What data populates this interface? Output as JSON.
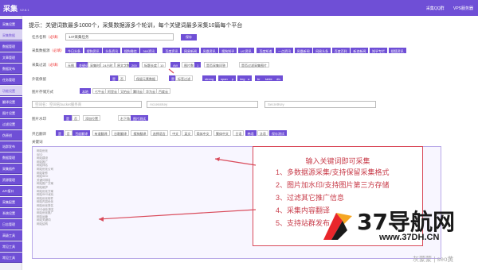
{
  "app": {
    "title": "采集",
    "version": "V2.8.1"
  },
  "topbar": {
    "links": [
      "采集QQ群",
      "VPS服务器"
    ]
  },
  "sidebar": {
    "items": [
      "采集设置",
      "采集数据",
      "数据管理",
      "文章管理",
      "数据发布",
      "任务管理",
      "功能设置",
      "翻译设置",
      "图片设置",
      "过滤设置",
      "伪原创",
      "站群发布",
      "数据管理",
      "采集插件",
      "资源管理",
      "API接口",
      "采集配置",
      "系统设置",
      "日志管理",
      "高级工具",
      "常见工具",
      "常见工具"
    ]
  },
  "tip": "提示：关键词数最多1000个，采集数据源多个轮训，每个关键词最多采集10篇每个平台",
  "form": {
    "task_name_label": "任务名称",
    "task_name_req": "（必填）",
    "task_name_value": "147采集任务",
    "save_button": "保存",
    "sources_label": "采集数据源",
    "sources_req": "（必填）",
    "sources": [
      "今日头条",
      "搜狗资讯",
      "头条资讯",
      "搜狗微信",
      "360资讯",
      "百度资讯",
      "网易新闻",
      "凤凰资讯",
      "搜狗知乎",
      "UC资讯",
      "百度知道",
      "一点资讯",
      "凤凰新闻",
      "网易头条",
      "百度百科",
      "新浪新闻",
      "知乎专栏",
      "搜狐资讯"
    ],
    "filter_label": "采集过滤",
    "filter_req": "（必填）",
    "filter_opts": [
      "无图",
      "关键词",
      "采集时间",
      "24小时",
      "原文字数",
      "200",
      "标题长度",
      "10",
      "4W",
      "图片数",
      "1",
      "是否采集问答",
      "是否过滤采集图片"
    ],
    "keep_label": "外链保留",
    "keep_opts": [
      "是",
      "否",
      "保留元素数据",
      "是",
      "标签过滤",
      "strong",
      "span",
      "p",
      "img",
      "a",
      "br",
      "table",
      "div"
    ],
    "storage_label": "图片存储方式",
    "storage_opts": [
      "本地",
      "七牛云",
      "阿里云",
      "又拍云",
      "腾讯云",
      "华为云",
      "百度云"
    ],
    "bucket_placeholder": "空间名：空间名bucket服务商",
    "accesskey_placeholder": "AccessKey",
    "secretkey_placeholder": "SecretKey",
    "watermark_label": "图片水印",
    "watermark_opts": [
      "是",
      "否",
      "添加位置",
      "右下角",
      "图片测试"
    ],
    "translate_label": "开启翻译",
    "translate_opts": [
      "是",
      "否",
      "百度翻译",
      "有道翻译",
      "谷歌翻译",
      "搜狗翻译",
      "选择语言",
      "中文",
      "英文",
      "简体中文",
      "繁体中文",
      "日语",
      "韩语",
      "法语",
      "保存测试"
    ],
    "keywords_label": "关键词"
  },
  "keywords": [
    "网站优化",
    "SEO",
    "网站建设",
    "网站推广",
    "网站排名",
    "网站优化公司",
    "网站制作",
    "网站SEO",
    "关键词排名",
    "网站推广方案",
    "网站维护",
    "网站优化方案",
    "网站SEO优化",
    "网站优化软件",
    "网站内容优化",
    "网站优化排名",
    "SEO优化排名",
    "网站优化推广",
    "网站运营",
    "网站关键词",
    "网站结构"
  ],
  "popup": {
    "title": "输入关键词即可采集",
    "items": [
      "1、多数据源采集/支持保留采集格式",
      "2、图片加水印/支持图片第三方存储",
      "3、过滤其它推广信息",
      "4、采集内容翻译",
      "5、支持站群发布"
    ]
  },
  "logo": {
    "text": "37导航网",
    "url": "www.37DH.CN"
  },
  "watermark": "灰蒙蒙 | seo黄"
}
